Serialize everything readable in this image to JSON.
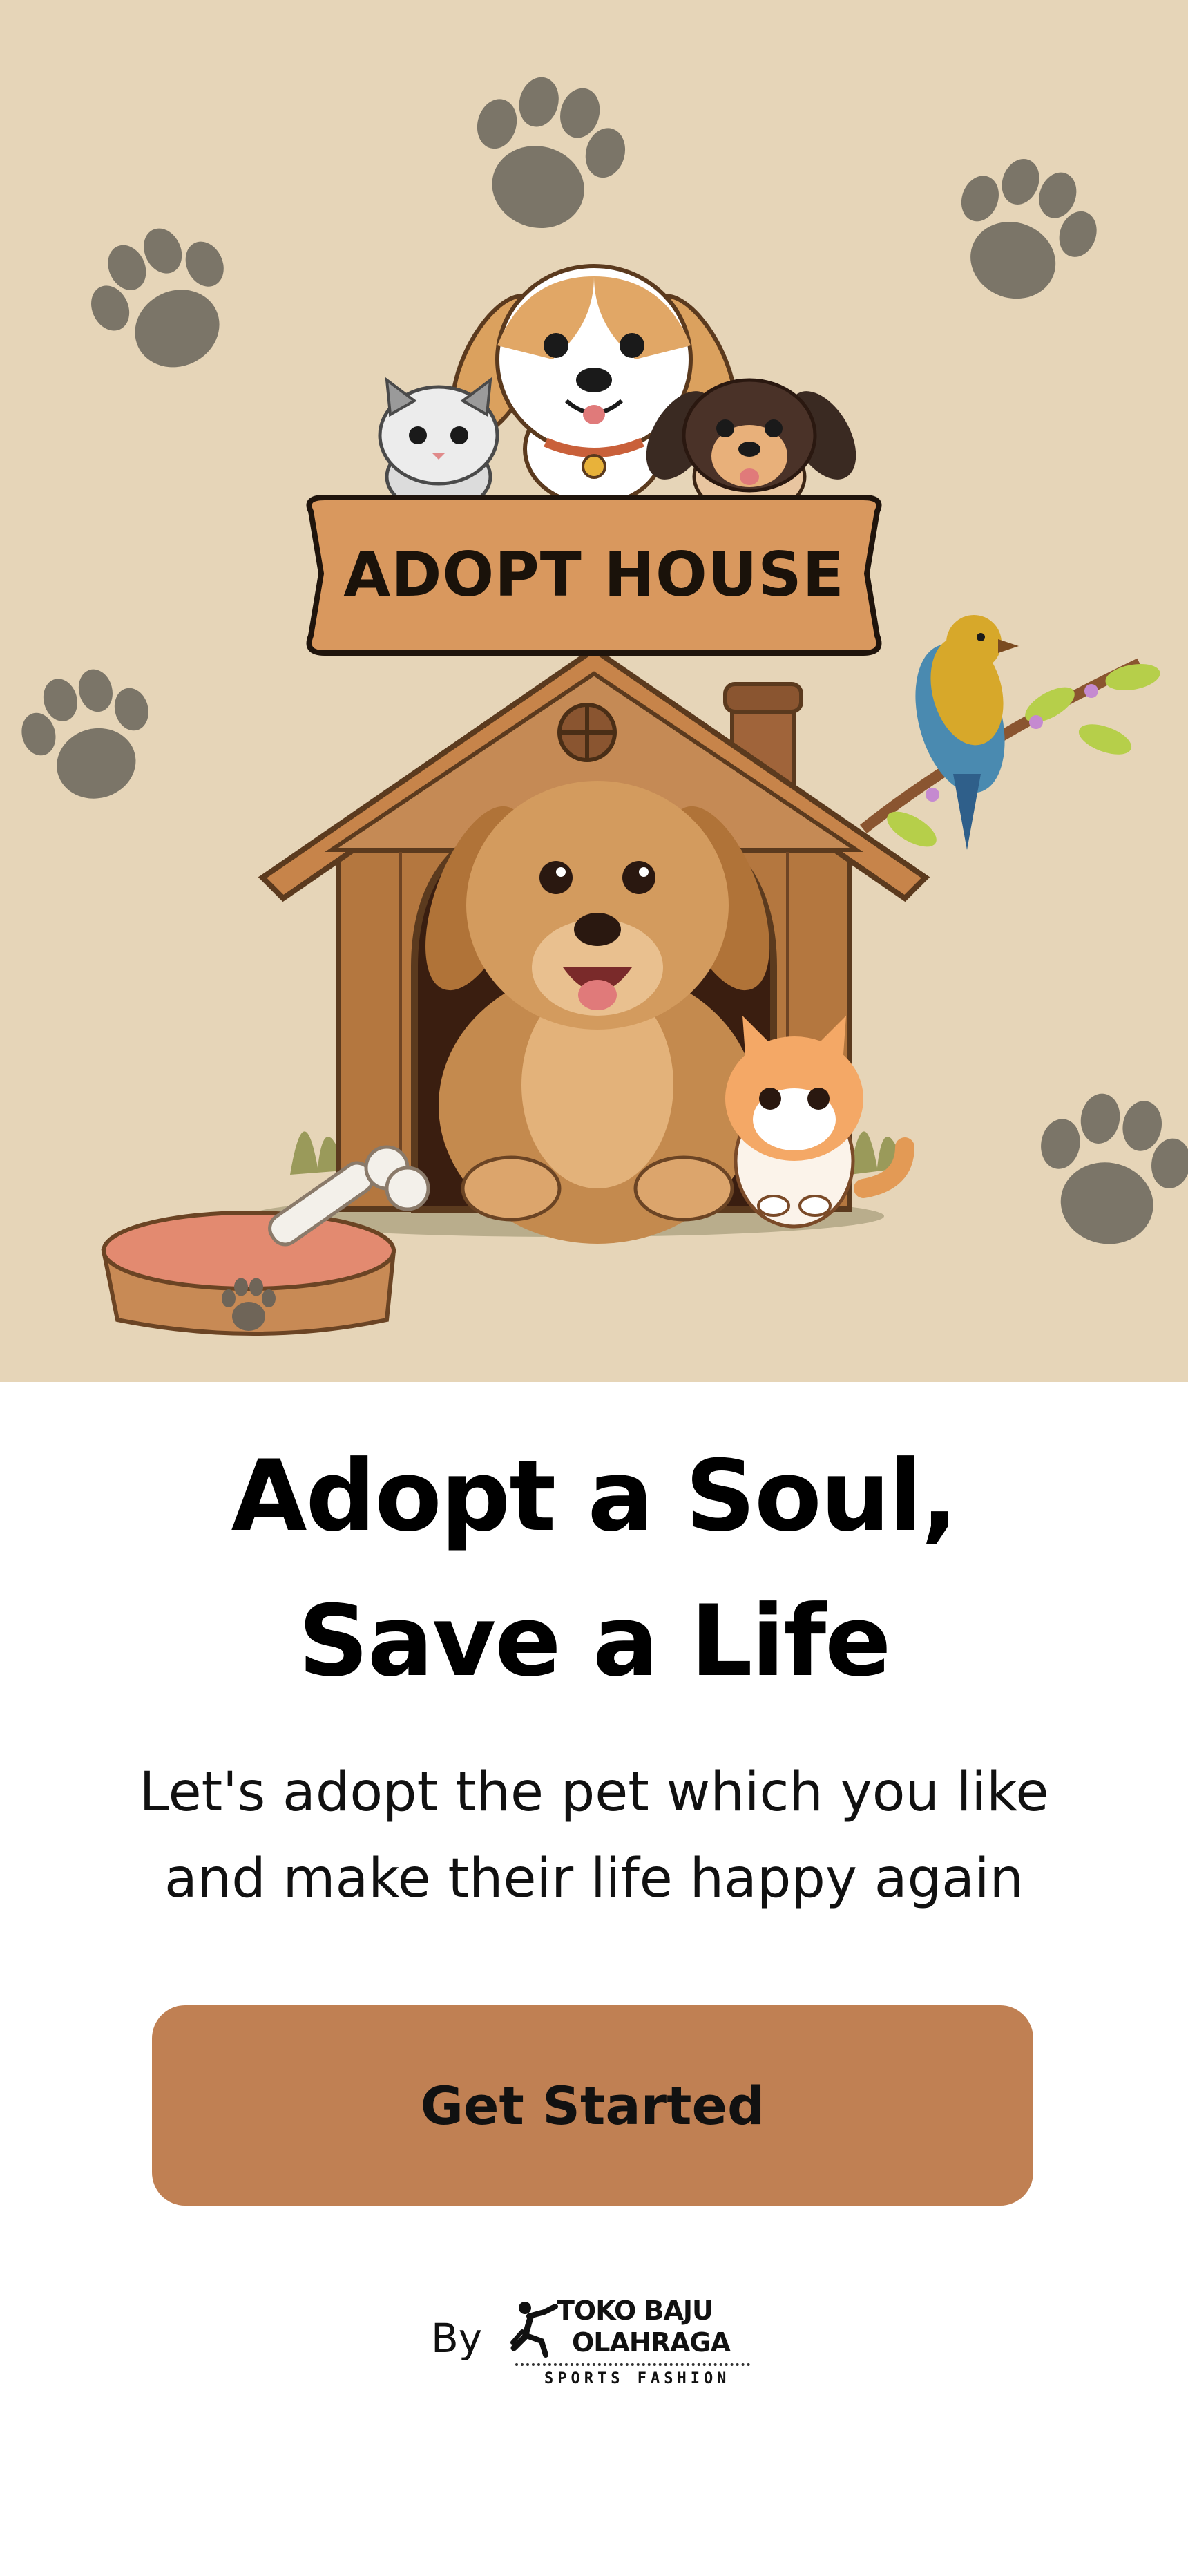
{
  "hero": {
    "sign_text": "ADOPT HOUSE",
    "background_color": "#e6d5b8",
    "icons": [
      "paw-print-icon",
      "dog-icon",
      "cat-icon",
      "bird-icon",
      "dog-house-icon",
      "food-bowl-icon",
      "bone-icon"
    ]
  },
  "headline": {
    "line1": "Adopt a Soul,",
    "line2": "Save a Life"
  },
  "subtitle": {
    "line1": "Let's adopt the pet which you like",
    "line2": "and make their life happy again"
  },
  "cta": {
    "label": "Get Started",
    "color": "#c08053"
  },
  "footer": {
    "by_label": "By",
    "brand_line1": "TOKO BAJU",
    "brand_line2": "OLAHRAGA",
    "brand_tagline": "SPORTS FASHION"
  }
}
